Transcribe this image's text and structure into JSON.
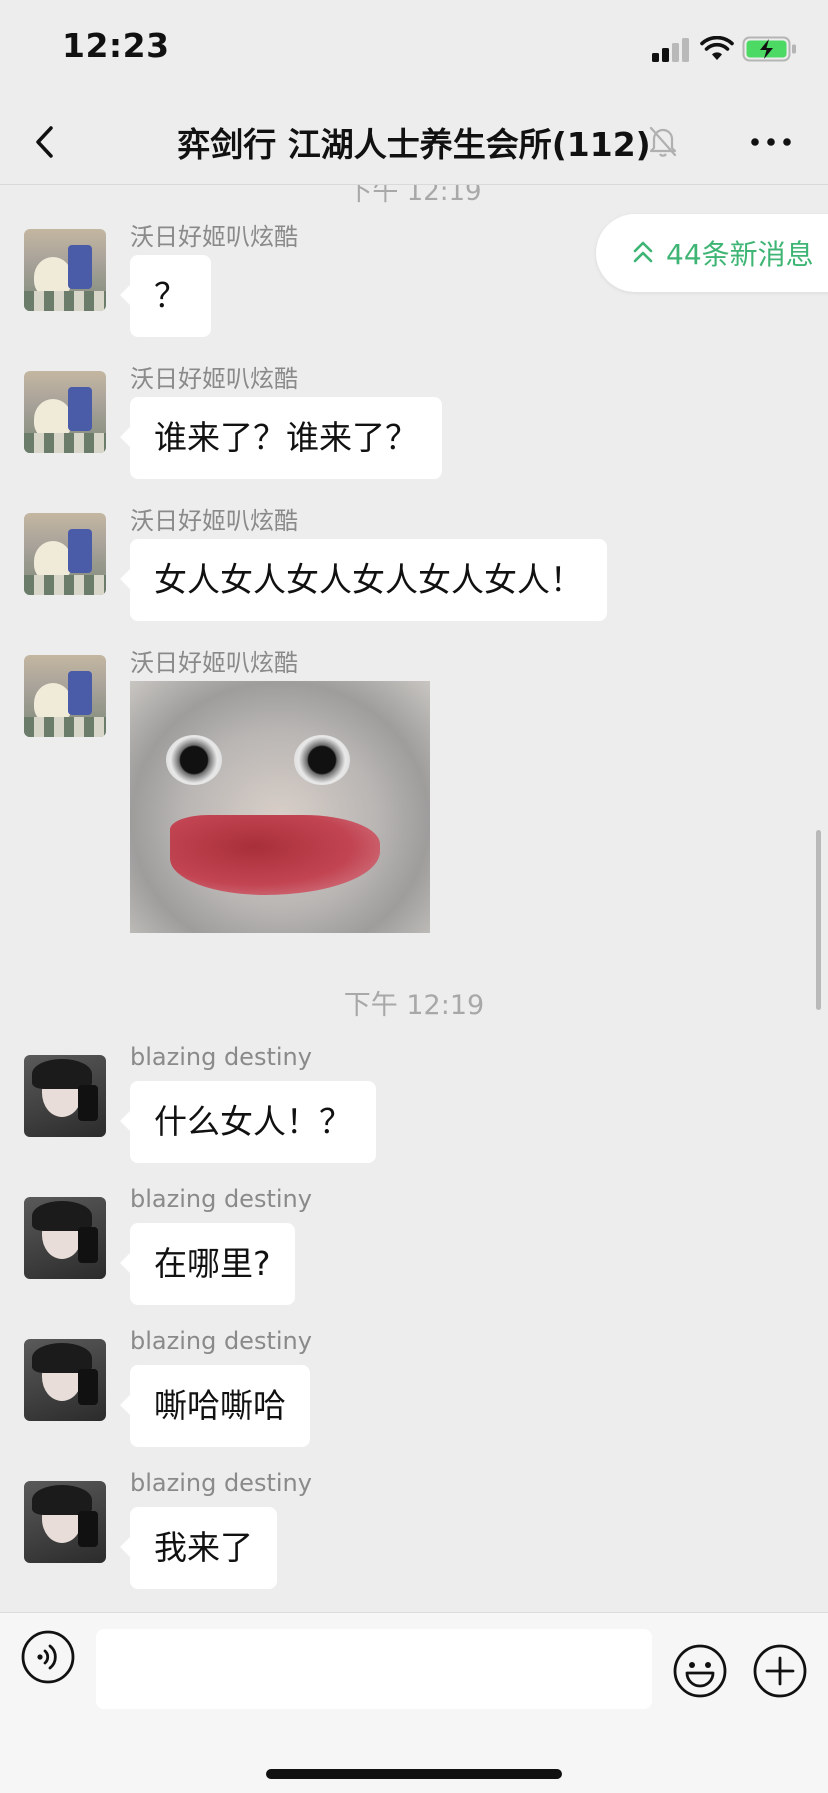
{
  "status_bar": {
    "time": "12:23",
    "icons": [
      "signal-icon",
      "wifi-icon",
      "battery-charging-icon"
    ]
  },
  "nav": {
    "title": "弈剑行 江湖人士养生会所(112)",
    "icons": [
      "back-icon",
      "mute-bell-icon",
      "more-icon"
    ]
  },
  "new_messages": {
    "label": "44条新消息",
    "icon": "double-chevron-up-icon",
    "color": "#3eb574"
  },
  "chat": {
    "peek_time": "下午 12:19",
    "messages": [
      {
        "sender": "沃日好姬叭炫酷",
        "text": "？"
      },
      {
        "sender": "沃日好姬叭炫酷",
        "text": "谁来了？谁来了？"
      },
      {
        "sender": "沃日好姬叭炫酷",
        "text": "女人女人女人女人女人女人！"
      },
      {
        "sender": "沃日好姬叭炫酷",
        "type": "sticker",
        "sticker": "grinning-gecko-sticker"
      },
      {
        "sender": "blazing destiny",
        "text": "什么女人！？"
      },
      {
        "sender": "blazing destiny",
        "text": "在哪里?"
      },
      {
        "sender": "blazing destiny",
        "text": "嘶哈嘶哈"
      },
      {
        "sender": "blazing destiny",
        "text": "我来了"
      }
    ],
    "time_divider": "下午 12:19"
  },
  "input_bar": {
    "value": "",
    "icons": [
      "voice-icon",
      "emoji-icon",
      "plus-icon"
    ]
  },
  "colors": {
    "background": "#ededed",
    "bubble": "#ffffff",
    "accent": "#3eb574"
  }
}
